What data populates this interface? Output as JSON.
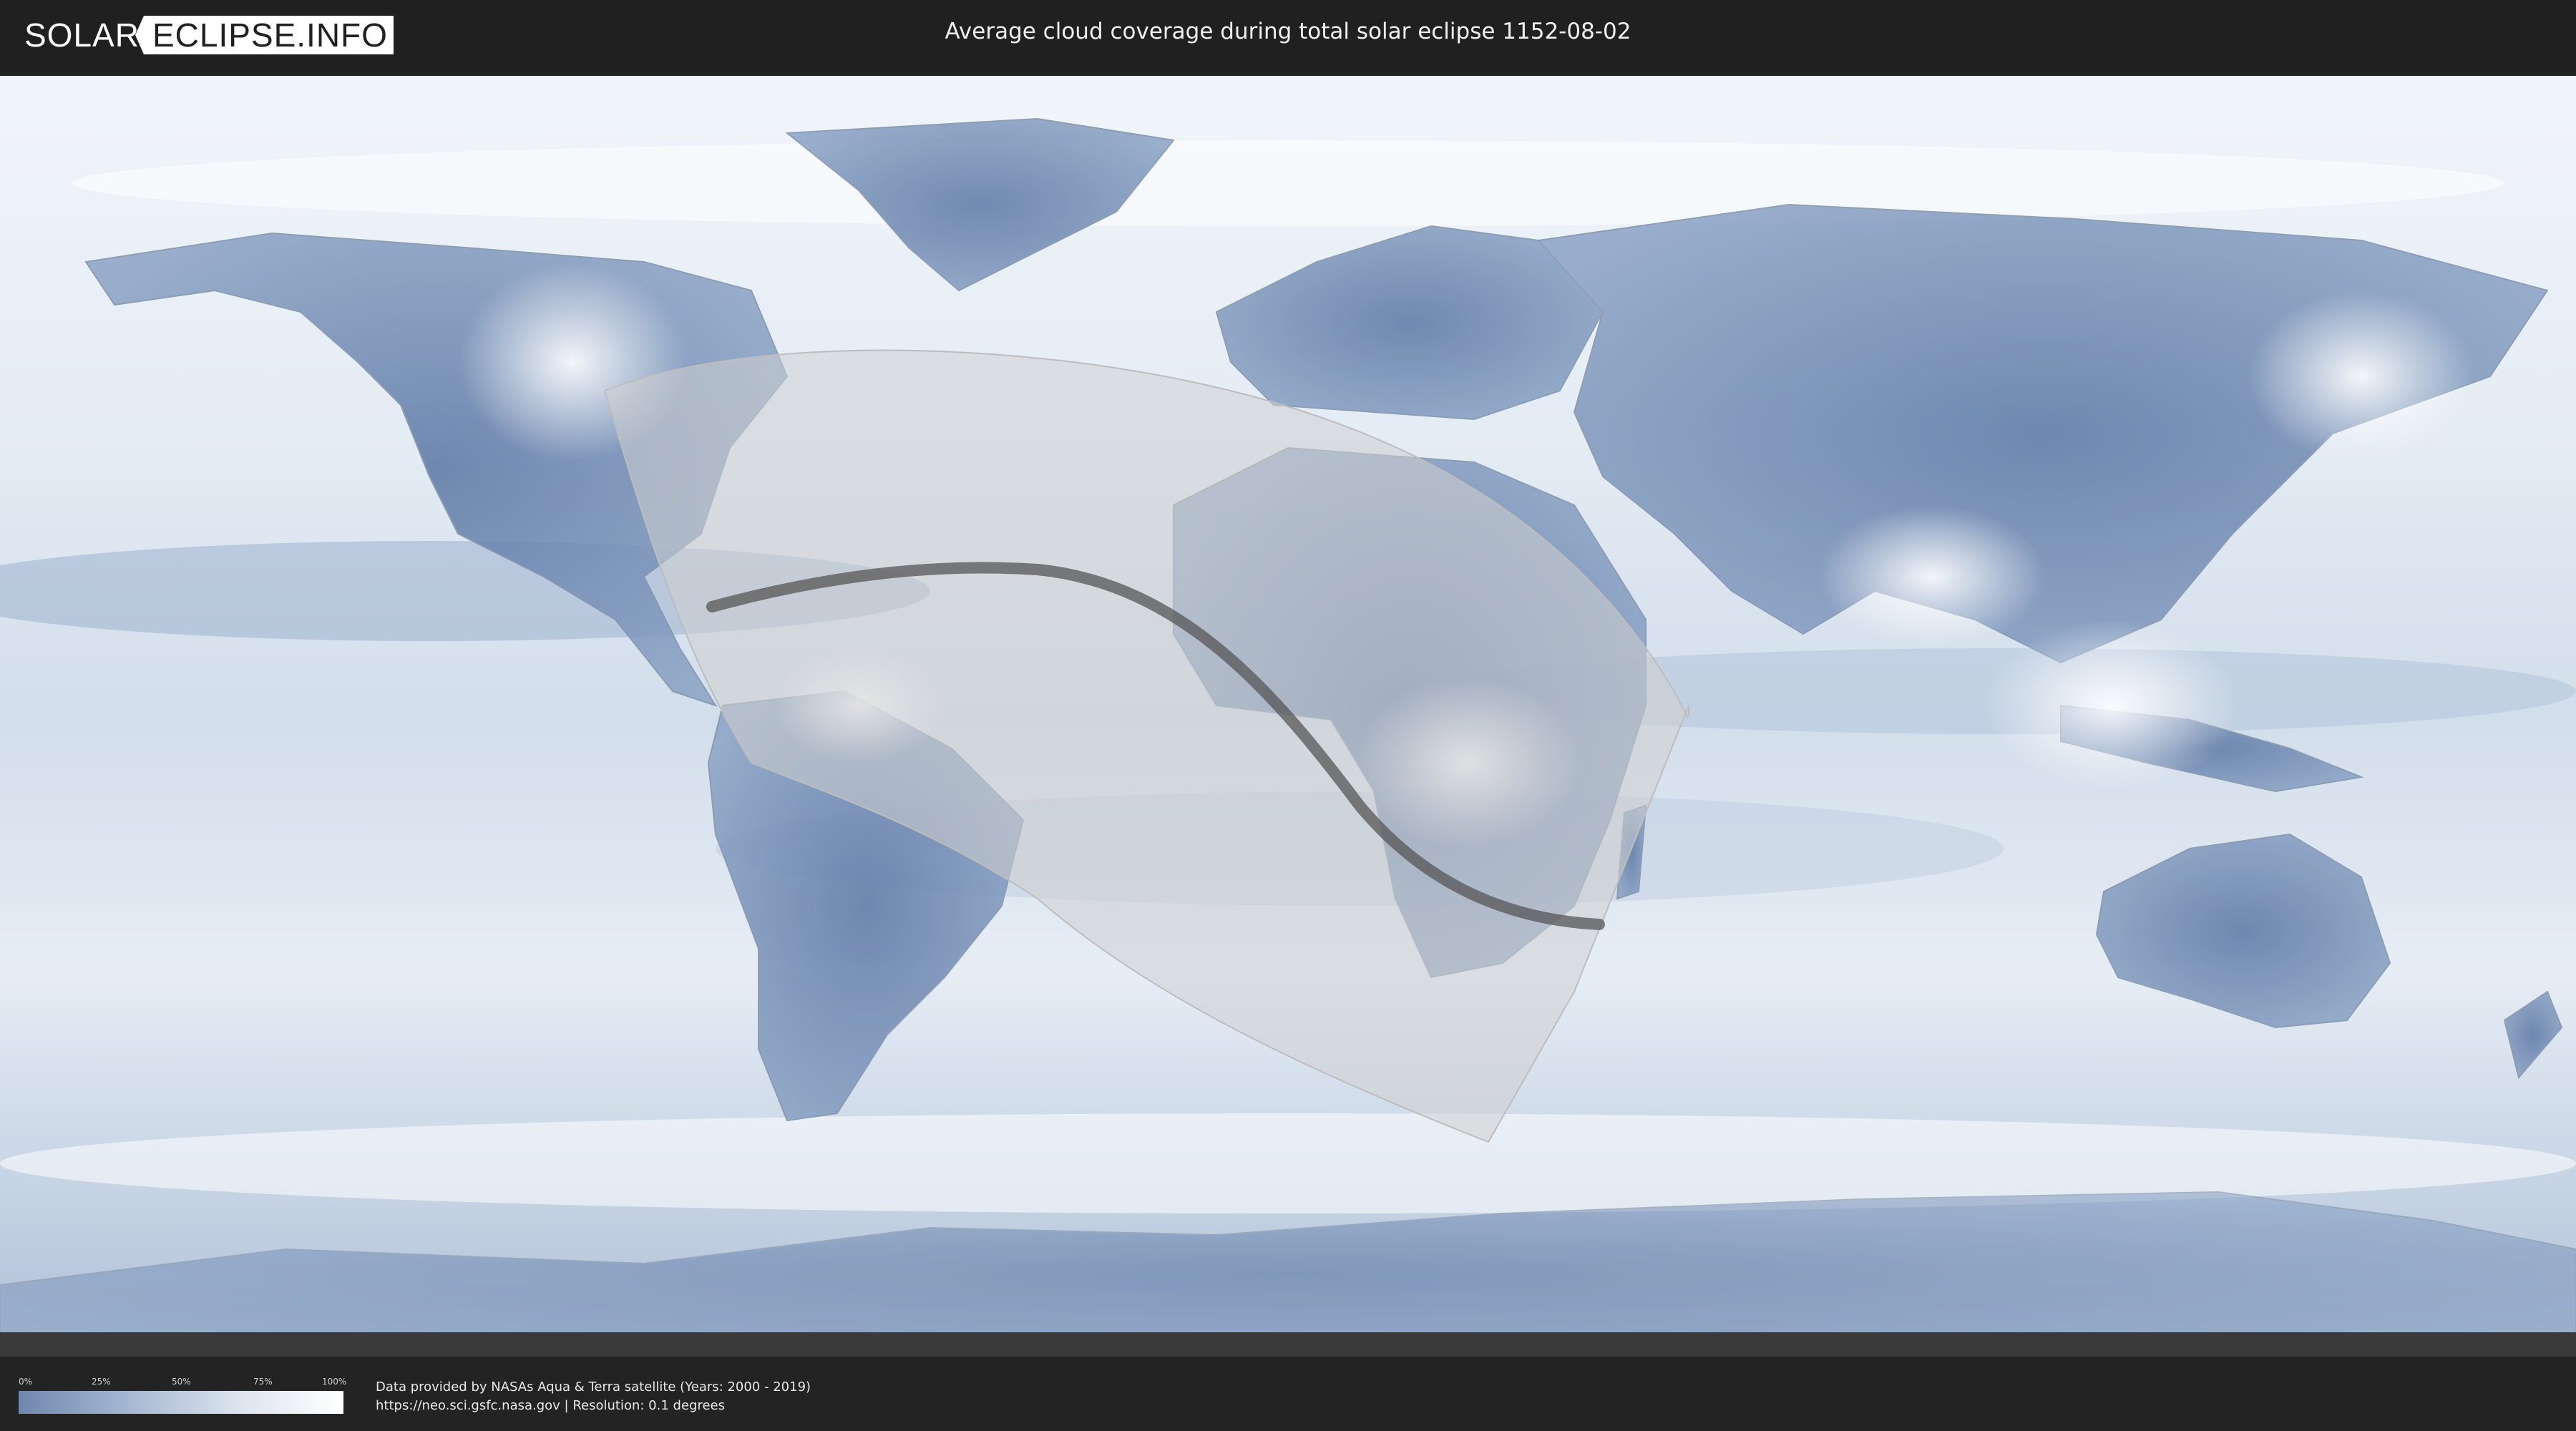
{
  "header": {
    "logo_part1": "SOLAR",
    "logo_part2": "ECLIPSE.INFO",
    "title": "Average cloud coverage during total solar eclipse 1152-08-02"
  },
  "legend": {
    "ticks": [
      "0%",
      "25%",
      "50%",
      "75%",
      "100%"
    ],
    "colors": {
      "clear": "#6f87ad",
      "cloudy": "#ffffff"
    }
  },
  "credits": {
    "line1": "Data provided by NASAs Aqua & Terra satellite (Years: 2000 - 2019)",
    "line2": "https://neo.sci.gsfc.nasa.gov | Resolution: 0.1 degrees"
  },
  "colors": {
    "background": "#202020",
    "ocean_cloud": "#e9eff6",
    "land_clear": "#5d79a6",
    "eclipse_zone": "#bdbdbd",
    "central_line": "#555555"
  }
}
